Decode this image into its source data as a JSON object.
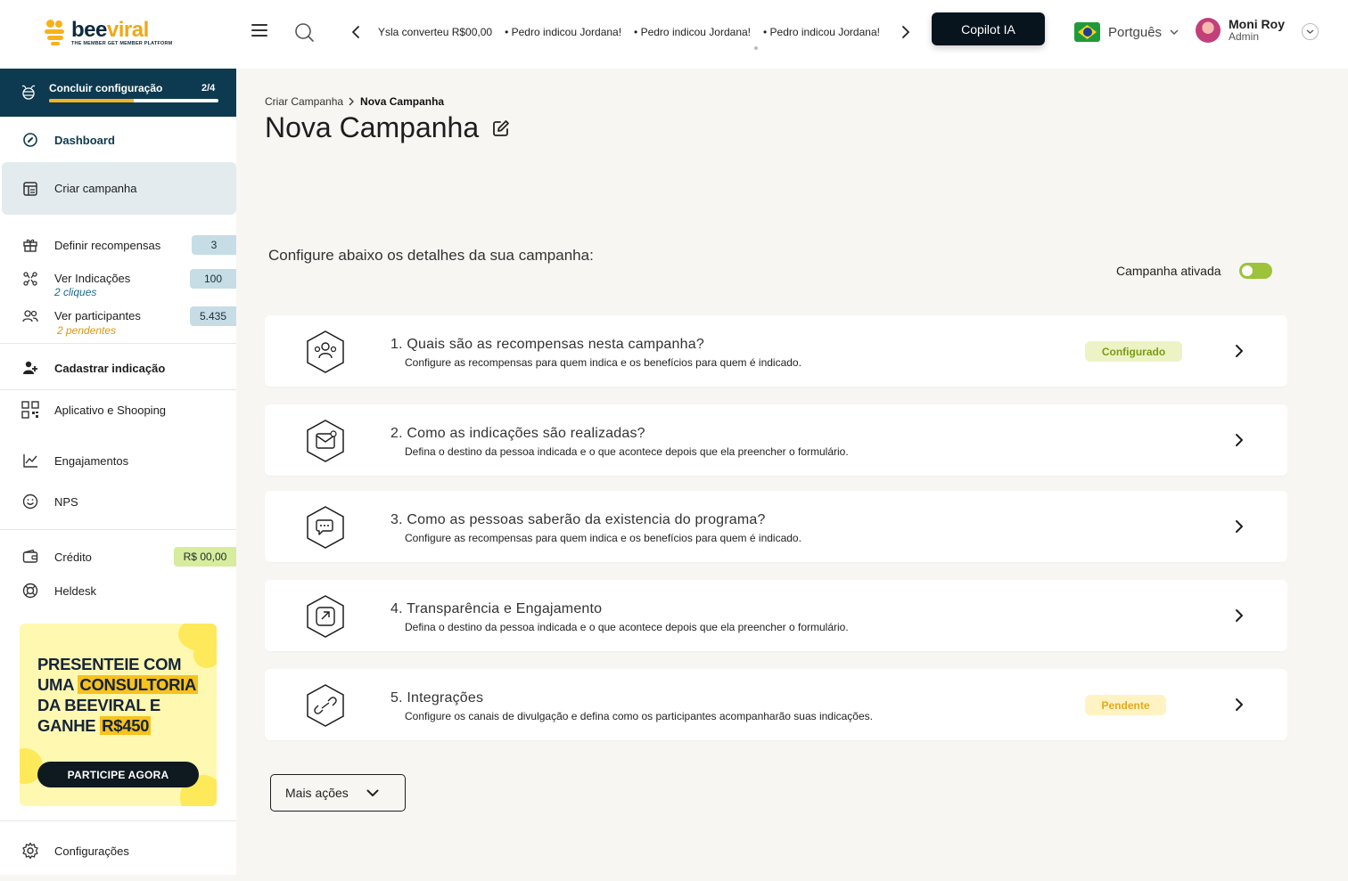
{
  "header": {
    "logo": {
      "word_a": "bee",
      "word_b": "viral",
      "tagline": "THE MEMBER GET MEMBER PLATFORM"
    },
    "ticker": [
      "Ysla converteu R$00,00",
      "• Pedro indicou Jordana!",
      "• Pedro indicou Jordana!",
      "• Pedro indicou Jordana!"
    ],
    "copilot_label": "Copilot IA",
    "language": "Portguês",
    "user": {
      "name": "Moni Roy",
      "role": "Admin"
    }
  },
  "sidebar": {
    "setup": {
      "label": "Concluir configuração",
      "count": "2/4",
      "progress": 0.5
    },
    "items": {
      "dashboard": {
        "label": "Dashboard"
      },
      "criar_campanha": {
        "label": "Criar campanha"
      },
      "recompensas": {
        "label": "Definir recompensas",
        "badge": "3"
      },
      "indicacoes": {
        "label": "Ver Indicações",
        "sub": "2 cliques",
        "badge": "100"
      },
      "participantes": {
        "label": "Ver participantes",
        "sub": "2 pendentes",
        "badge": "5.435"
      },
      "cadastrar": {
        "label": "Cadastrar indicação"
      },
      "aplicativo": {
        "label": "Aplicativo e Shooping"
      },
      "engajamentos": {
        "label": "Engajamentos"
      },
      "nps": {
        "label": "NPS"
      },
      "credito": {
        "label": "Crédito",
        "badge": "R$ 00,00"
      },
      "helpdesk": {
        "label": "Heldesk"
      },
      "configuracoes": {
        "label": "Configurações"
      }
    },
    "promo": {
      "line1": "PRESENTEIE COM",
      "line2a": "UMA ",
      "line2b": "CONSULTORIA",
      "line3": "DA BEEVIRAL E",
      "line4a": "GANHE ",
      "line4b": "R$450",
      "button": "PARTICIPE AGORA"
    }
  },
  "main": {
    "breadcrumb": {
      "parent": "Criar Campanha",
      "current": "Nova Campanha"
    },
    "title": "Nova Campanha",
    "intro": "Configure abaixo os detalhes da sua campanha:",
    "toggle_label": "Campanha ativada",
    "toggle_on": true,
    "steps": [
      {
        "title": "1. Quais são as recompensas nesta campanha?",
        "desc": "Configure as recompensas para quem indica e os benefícios para quem é indicado.",
        "status": "Configurado"
      },
      {
        "title": "2. Como as indicações são realizadas?",
        "desc": "Defina o destino da pessoa indicada e o que acontece depois que ela preencher o formulário.",
        "status": ""
      },
      {
        "title": "3. Como as pessoas saberão da existencia do programa?",
        "desc": "Configure as recompensas para quem indica e os benefícios para quem é indicado.",
        "status": ""
      },
      {
        "title": "4. Transparência e Engajamento",
        "desc": "Defina o destino da pessoa indicada e o que acontece depois que ela preencher o formulário.",
        "status": ""
      },
      {
        "title": "5. Integrações",
        "desc": "Configure os canais de divulgação e defina como os participantes acompanharão suas indicações.",
        "status": "Pendente"
      }
    ],
    "more_actions": "Mais ações"
  },
  "colors": {
    "brand_dark": "#0d3a50",
    "brand_yellow": "#f2b521",
    "toggle_on": "#9cc33a",
    "status_configured_bg": "#edf3c4",
    "status_configured_fg": "#7a9b14",
    "status_pending_bg": "#fff3c4",
    "status_pending_fg": "#e6a817"
  }
}
